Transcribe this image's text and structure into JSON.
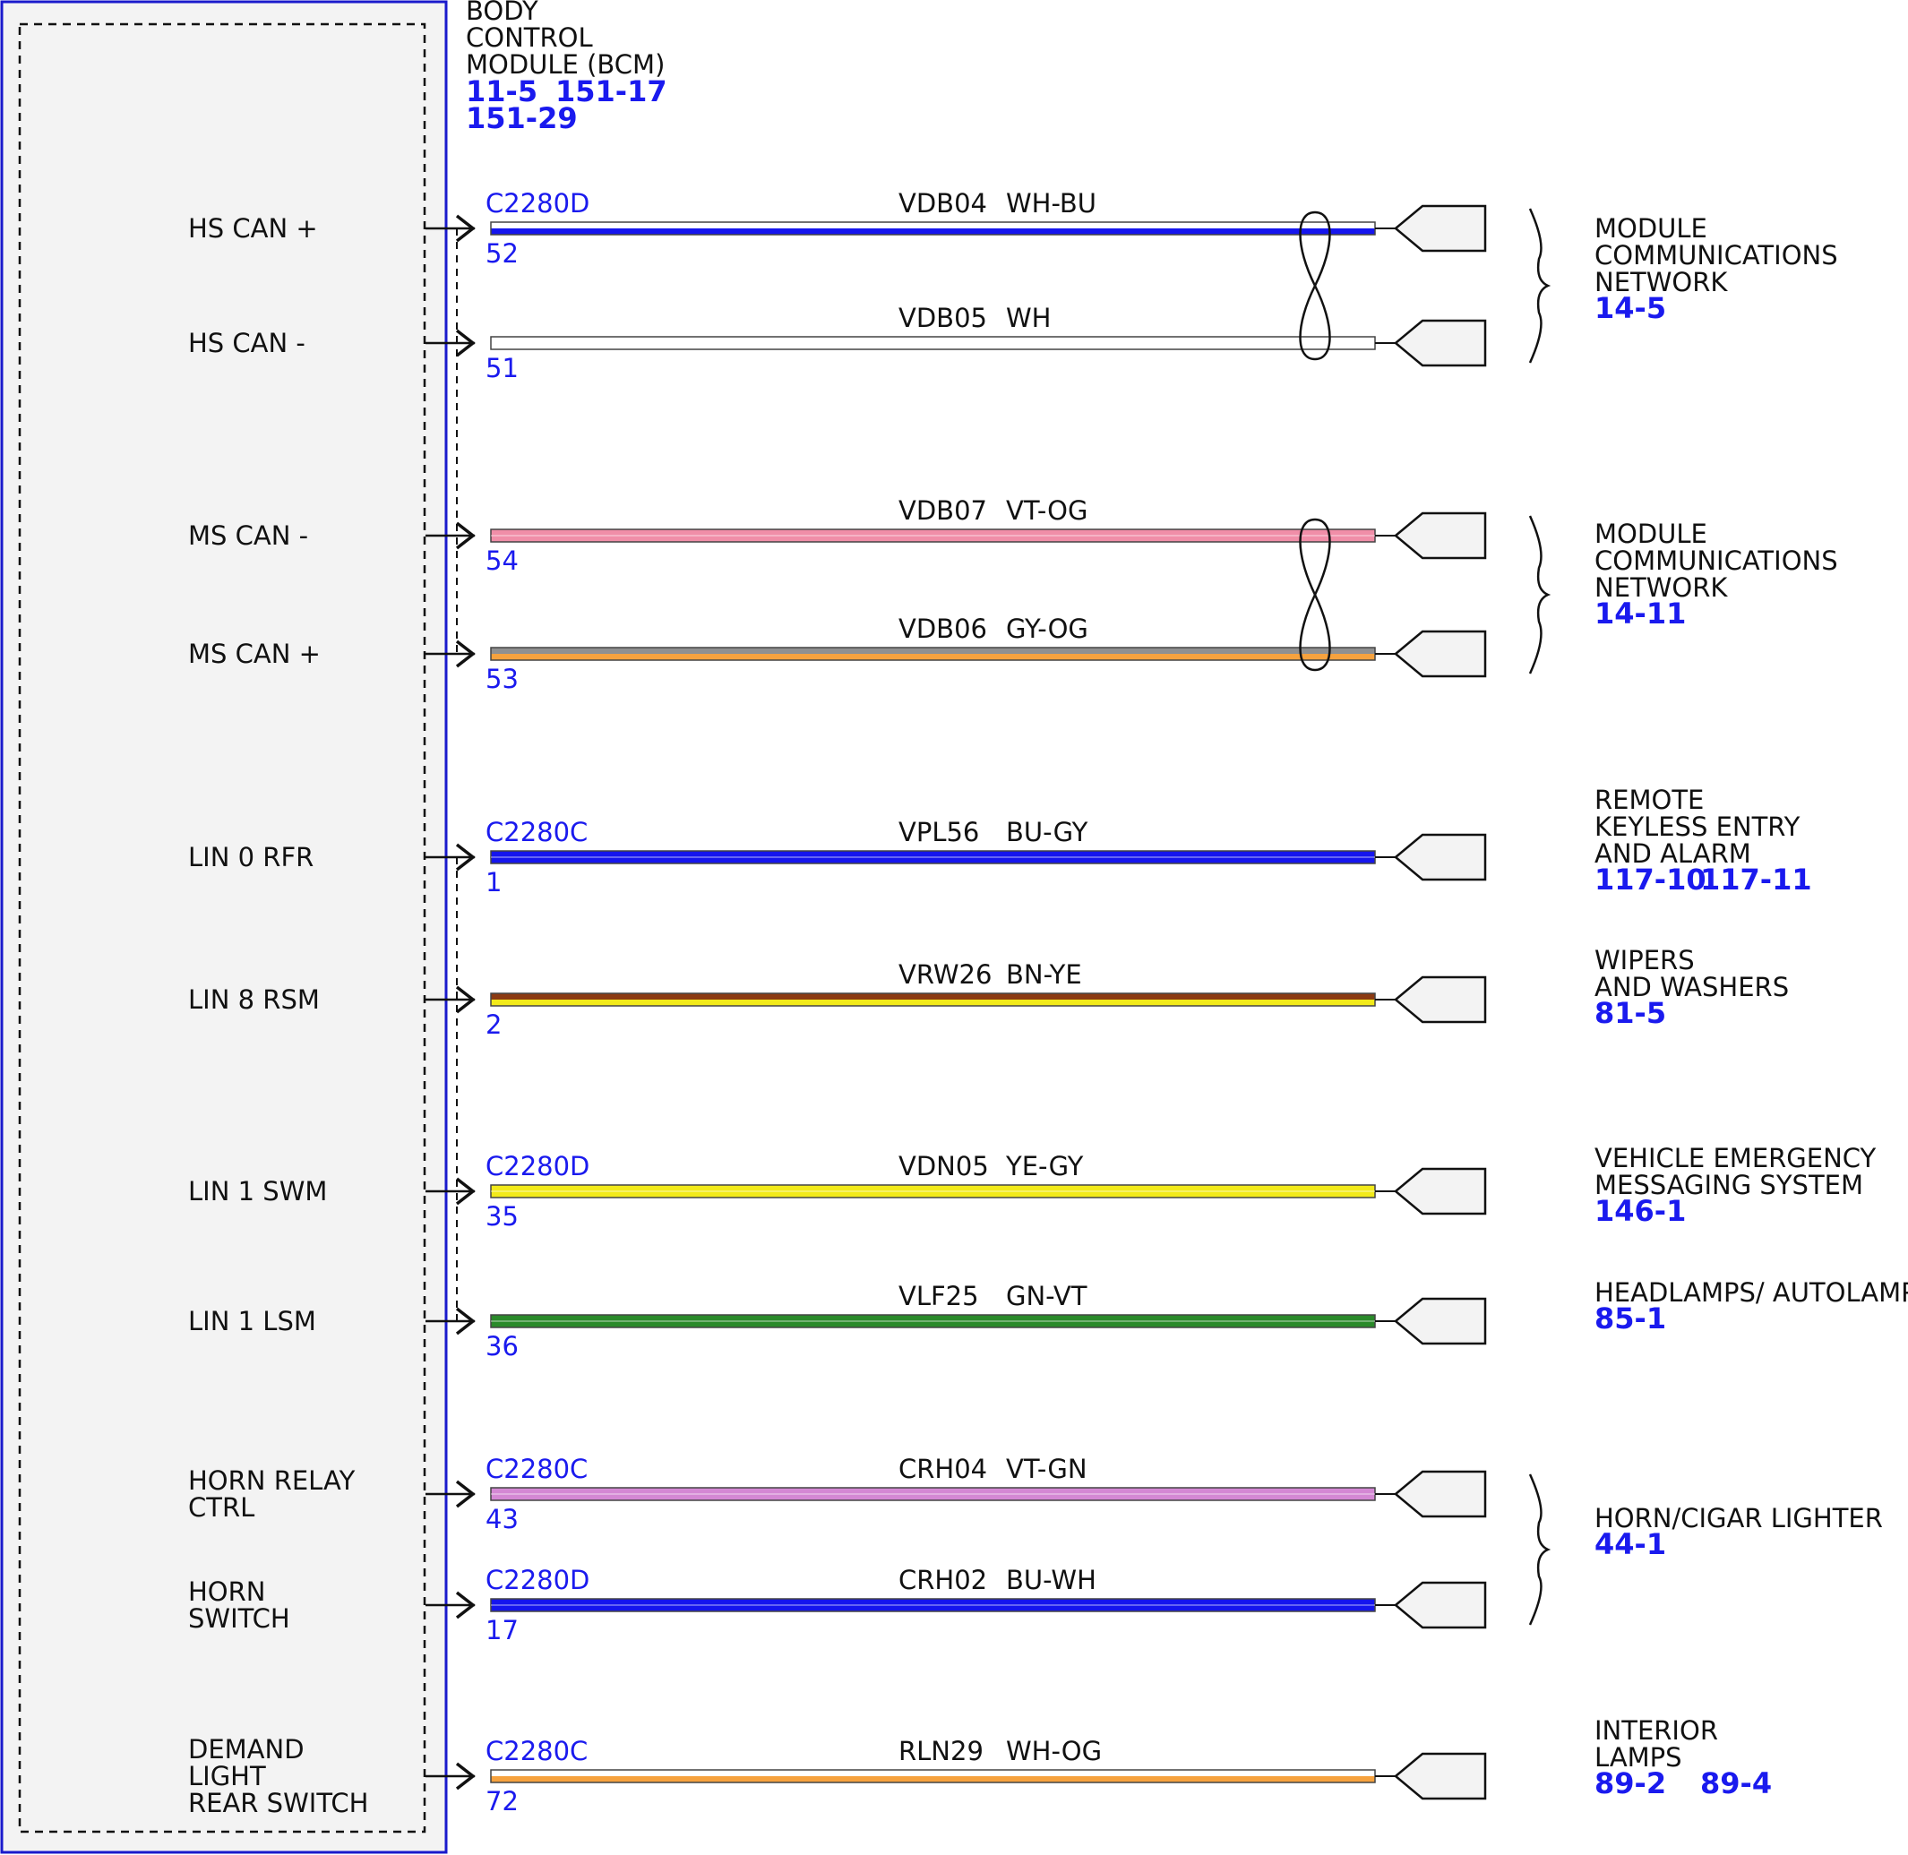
{
  "module": {
    "title_lines": [
      "BODY",
      "CONTROL",
      "MODULE (BCM)"
    ],
    "refs": [
      "11-5",
      "151-17",
      "151-29"
    ]
  },
  "colors": {
    "WH": "#ffffff",
    "BU": "#1515ee",
    "VT": "#d488d4",
    "OG": "#f6a23e",
    "GY": "#909090",
    "BN": "#8b3a12",
    "YE": "#f2ea1a",
    "GN": "#2a8a2a",
    "PK": "#f08ea8",
    "module_border": "#1a1acc",
    "module_fill": "#f3f3f3"
  },
  "circuits": [
    {
      "pin_label": [
        "HS CAN +"
      ],
      "connector": "C2280D",
      "pin": "52",
      "circuit": "VDB04",
      "wire_color": "WH-BU",
      "stripes": [
        "WH",
        "BU"
      ]
    },
    {
      "pin_label": [
        "HS CAN -"
      ],
      "connector": "",
      "pin": "51",
      "circuit": "VDB05",
      "wire_color": "WH",
      "stripes": [
        "WH"
      ]
    },
    {
      "pin_label": [
        "MS CAN -"
      ],
      "connector": "",
      "pin": "54",
      "circuit": "VDB07",
      "wire_color": "VT-OG",
      "stripes": [
        "PK",
        "PK"
      ]
    },
    {
      "pin_label": [
        "MS CAN +"
      ],
      "connector": "",
      "pin": "53",
      "circuit": "VDB06",
      "wire_color": "GY-OG",
      "stripes": [
        "GY",
        "OG"
      ]
    },
    {
      "pin_label": [
        "LIN 0 RFR"
      ],
      "connector": "C2280C",
      "pin": "1",
      "circuit": "VPL56",
      "wire_color": "BU-GY",
      "stripes": [
        "BU",
        "BU"
      ]
    },
    {
      "pin_label": [
        "LIN 8 RSM"
      ],
      "connector": "",
      "pin": "2",
      "circuit": "VRW26",
      "wire_color": "BN-YE",
      "stripes": [
        "BN",
        "YE"
      ]
    },
    {
      "pin_label": [
        "LIN 1 SWM"
      ],
      "connector": "C2280D",
      "pin": "35",
      "circuit": "VDN05",
      "wire_color": "YE-GY",
      "stripes": [
        "YE",
        "YE"
      ]
    },
    {
      "pin_label": [
        "LIN 1 LSM"
      ],
      "connector": "",
      "pin": "36",
      "circuit": "VLF25",
      "wire_color": "GN-VT",
      "stripes": [
        "GN",
        "GN"
      ]
    },
    {
      "pin_label": [
        "HORN RELAY",
        "CTRL"
      ],
      "connector": "C2280C",
      "pin": "43",
      "circuit": "CRH04",
      "wire_color": "VT-GN",
      "stripes": [
        "VT",
        "VT"
      ]
    },
    {
      "pin_label": [
        "HORN",
        "SWITCH"
      ],
      "connector": "C2280D",
      "pin": "17",
      "circuit": "CRH02",
      "wire_color": "BU-WH",
      "stripes": [
        "BU",
        "BU"
      ]
    },
    {
      "pin_label": [
        "DEMAND",
        "LIGHT",
        "REAR SWITCH"
      ],
      "connector": "C2280C",
      "pin": "72",
      "circuit": "RLN29",
      "wire_color": "WH-OG",
      "stripes": [
        "WH",
        "OG"
      ]
    }
  ],
  "destinations": [
    {
      "lines": [
        "MODULE",
        "COMMUNICATIONS",
        "NETWORK"
      ],
      "refs": [
        "14-5"
      ]
    },
    {
      "lines": [
        "MODULE",
        "COMMUNICATIONS",
        "NETWORK"
      ],
      "refs": [
        "14-11"
      ]
    },
    {
      "lines": [
        "REMOTE",
        "KEYLESS ENTRY",
        "AND ALARM"
      ],
      "refs": [
        "117-10",
        "117-11"
      ]
    },
    {
      "lines": [
        "WIPERS",
        "AND WASHERS"
      ],
      "refs": [
        "81-5"
      ]
    },
    {
      "lines": [
        "VEHICLE EMERGENCY",
        "MESSAGING SYSTEM"
      ],
      "refs": [
        "146-1"
      ]
    },
    {
      "lines": [
        "HEADLAMPS/ AUTOLAMPS"
      ],
      "refs": [
        "85-1"
      ]
    },
    {
      "lines": [
        "HORN/CIGAR LIGHTER"
      ],
      "refs": [
        "44-1"
      ]
    },
    {
      "lines": [
        "INTERIOR",
        "LAMPS"
      ],
      "refs": [
        "89-2",
        "89-4"
      ]
    }
  ]
}
